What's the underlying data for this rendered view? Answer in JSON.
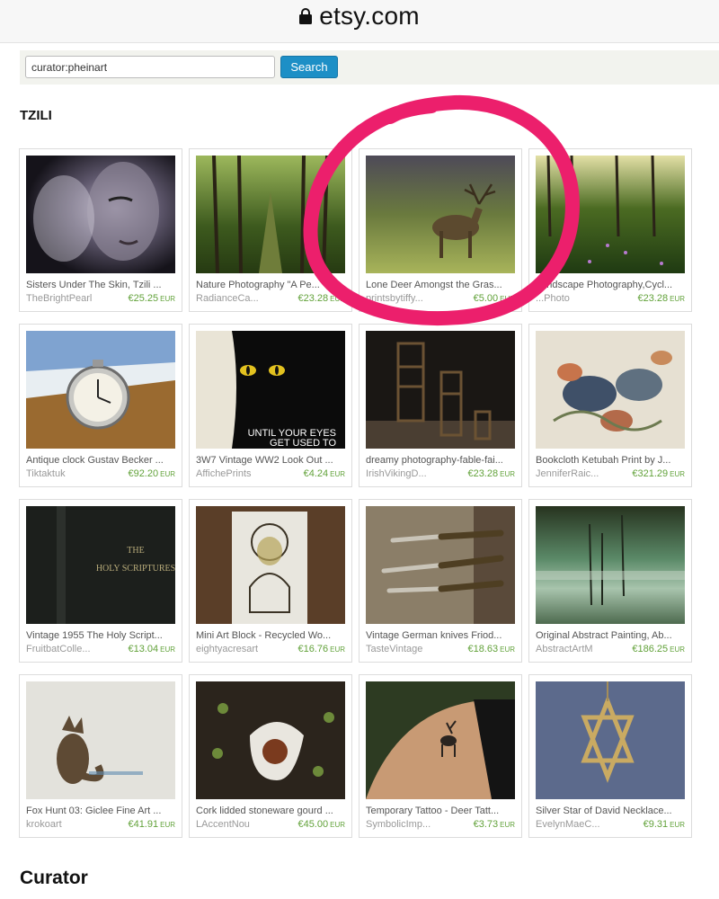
{
  "browser": {
    "domain": "etsy.com"
  },
  "search": {
    "value": "curator:pheinart",
    "button_label": "Search"
  },
  "section": {
    "title": "TZILI"
  },
  "footer": {
    "title": "Curator"
  },
  "highlight_color": "#ec1f6c",
  "price_color": "#62a23a",
  "listings": [
    {
      "title": "Sisters Under The Skin, Tzili ...",
      "shop": "TheBrightPearl",
      "price": "€25.25",
      "currency": "EUR"
    },
    {
      "title": "Nature Photography \"A Pe...",
      "shop": "RadianceCa...",
      "price": "€23.28",
      "currency": "EUR"
    },
    {
      "title": "Lone Deer Amongst the Gras...",
      "shop": "printsbytiffy...",
      "price": "€5.00",
      "currency": "EUR"
    },
    {
      "title": "Landscape Photography,Cycl...",
      "shop": "...Photo",
      "price": "€23.28",
      "currency": "EUR"
    },
    {
      "title": "Antique clock Gustav Becker ...",
      "shop": "Tiktaktuk",
      "price": "€92.20",
      "currency": "EUR"
    },
    {
      "title": "3W7 Vintage WW2 Look Out ...",
      "shop": "AfficheP​rints",
      "price": "€4.24",
      "currency": "EUR"
    },
    {
      "title": "dreamy photography-fable-fai...",
      "shop": "IrishVikingD...",
      "price": "€23.28",
      "currency": "EUR"
    },
    {
      "title": "Bookcloth Ketubah Print by J...",
      "shop": "JenniferRaic...",
      "price": "€321.29",
      "currency": "EUR"
    },
    {
      "title": "Vintage 1955 The Holy Script...",
      "shop": "FruitbatColle...",
      "price": "€13.04",
      "currency": "EUR"
    },
    {
      "title": "Mini Art Block - Recycled Wo...",
      "shop": "eightyacresart",
      "price": "€16.76",
      "currency": "EUR"
    },
    {
      "title": "Vintage German knives Friod...",
      "shop": "TasteVintage",
      "price": "€18.63",
      "currency": "EUR"
    },
    {
      "title": "Original Abstract Painting, Ab...",
      "shop": "AbstractArtM",
      "price": "€186.25",
      "currency": "EUR"
    },
    {
      "title": "Fox Hunt 03: Giclee Fine Art ...",
      "shop": "krokoart",
      "price": "€41.91",
      "currency": "EUR"
    },
    {
      "title": "Cork lidded stoneware gourd ...",
      "shop": "LAccentNou",
      "price": "€45.00",
      "currency": "EUR"
    },
    {
      "title": "Temporary Tattoo - Deer Tatt...",
      "shop": "SymbolicImp...",
      "price": "€3.73",
      "currency": "EUR"
    },
    {
      "title": "Silver Star of David Necklace...",
      "shop": "EvelynMaeC...",
      "price": "€9.31",
      "currency": "EUR"
    }
  ],
  "poster_text": [
    "UNTIL YOUR EYES",
    "GET USED TO"
  ],
  "book_text": [
    "THE",
    "HOLY SCRIPTURES"
  ]
}
